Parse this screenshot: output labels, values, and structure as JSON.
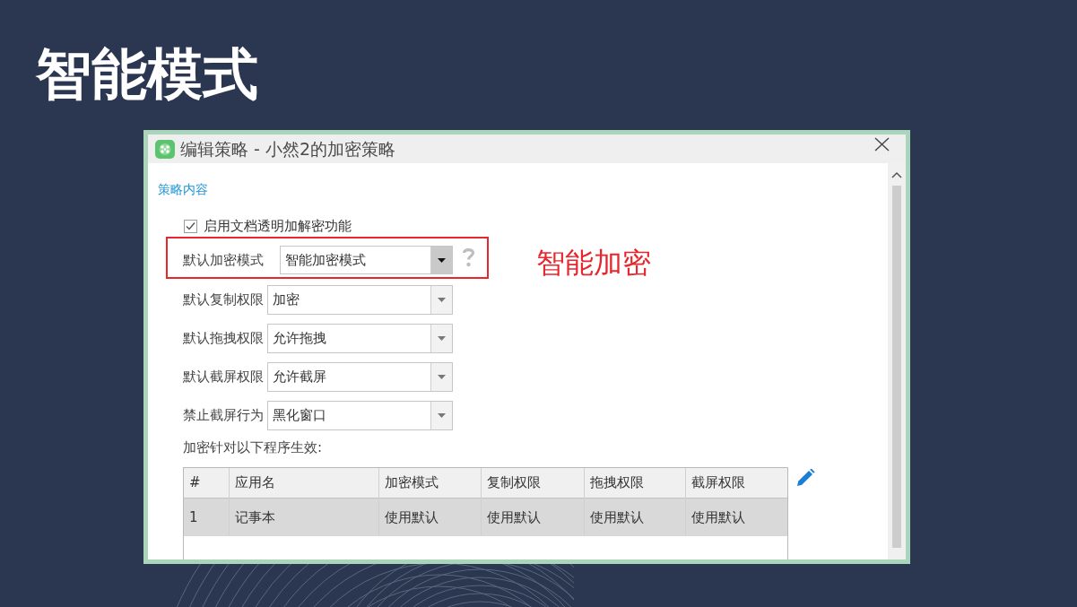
{
  "slide": {
    "title": "智能模式"
  },
  "dialog": {
    "title": "编辑策略 - 小然2的加密策略",
    "section_title": "策略内容",
    "checkbox": {
      "label": "启用文档透明加解密功能",
      "checked": true
    },
    "fields": [
      {
        "label": "默认加密模式",
        "value": "智能加密模式",
        "focused": true,
        "highlighted": true,
        "help": true,
        "annotation": "智能加密"
      },
      {
        "label": "默认复制权限",
        "value": "加密",
        "focused": false,
        "highlighted": false,
        "help": false
      },
      {
        "label": "默认拖拽权限",
        "value": "允许拖拽",
        "focused": false,
        "highlighted": false,
        "help": false
      },
      {
        "label": "默认截屏权限",
        "value": "允许截屏",
        "focused": false,
        "highlighted": false,
        "help": false
      },
      {
        "label": "禁止截屏行为",
        "value": "黑化窗口",
        "focused": false,
        "highlighted": false,
        "help": false
      }
    ],
    "table_caption": "加密针对以下程序生效:",
    "table": {
      "columns": [
        "#",
        "应用名",
        "加密模式",
        "复制权限",
        "拖拽权限",
        "截屏权限"
      ],
      "rows": [
        {
          "cells": [
            "1",
            "记事本",
            "使用默认",
            "使用默认",
            "使用默认",
            "使用默认"
          ],
          "selected": true
        }
      ]
    }
  }
}
